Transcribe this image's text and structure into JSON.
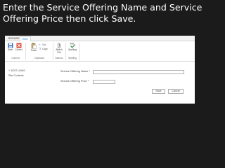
{
  "instruction": "Enter the Service Offering Name and Service Offering Price then click Save.",
  "tabs": [
    {
      "label": "BROWSE"
    },
    {
      "label": "EDIT"
    }
  ],
  "ribbon": {
    "save": "Save",
    "cancel": "Cancel",
    "paste": "Paste",
    "cut": "Cut",
    "copy": "Copy",
    "attach_file": "Attach File",
    "spelling": "Spelling",
    "groups": {
      "commit": "Commit",
      "clipboard": "Clipboard",
      "actions": "Actions",
      "spelling": "Spelling"
    }
  },
  "nav": {
    "edit_links": "EDIT LINKS",
    "site_contents": "Site Contents"
  },
  "form": {
    "name_label": "Service Offering Name *",
    "name_value": "",
    "price_label": "Service Offering Price *",
    "price_value": "",
    "save": "Save",
    "cancel": "Cancel"
  }
}
